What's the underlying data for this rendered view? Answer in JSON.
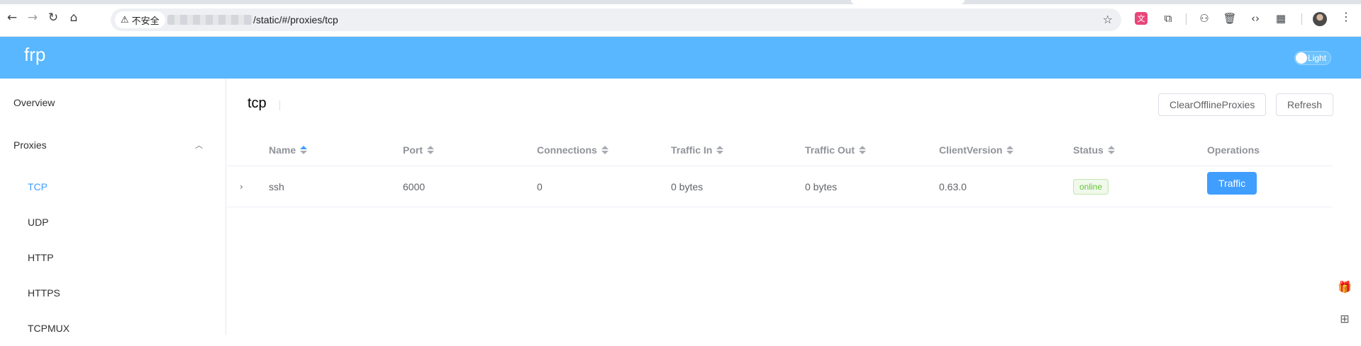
{
  "browser": {
    "security_label": "不安全",
    "url_path": "/static/#/proxies/tcp",
    "icons": {
      "back": "back-arrow-icon",
      "forward": "forward-arrow-icon",
      "reload": "reload-icon",
      "home": "home-icon",
      "warning": "warning-triangle-icon",
      "star": "bookmark-star-icon"
    }
  },
  "app": {
    "brand": "frp",
    "theme_label": "Light",
    "accent_color": "#58b7ff"
  },
  "sidebar": {
    "overview": "Overview",
    "proxies": "Proxies",
    "subitems": [
      "TCP",
      "UDP",
      "HTTP",
      "HTTPS",
      "TCPMUX"
    ],
    "active": "TCP"
  },
  "main": {
    "title": "tcp",
    "clear_button": "ClearOfflineProxies",
    "refresh_button": "Refresh",
    "columns": [
      "Name",
      "Port",
      "Connections",
      "Traffic In",
      "Traffic Out",
      "ClientVersion",
      "Status",
      "Operations"
    ],
    "rows": [
      {
        "name": "ssh",
        "port": "6000",
        "connections": "0",
        "traffic_in": "0 bytes",
        "traffic_out": "0 bytes",
        "client_version": "0.63.0",
        "status": "online",
        "operation": "Traffic"
      }
    ],
    "status_color": "#67c23a",
    "primary_color": "#409eff"
  }
}
